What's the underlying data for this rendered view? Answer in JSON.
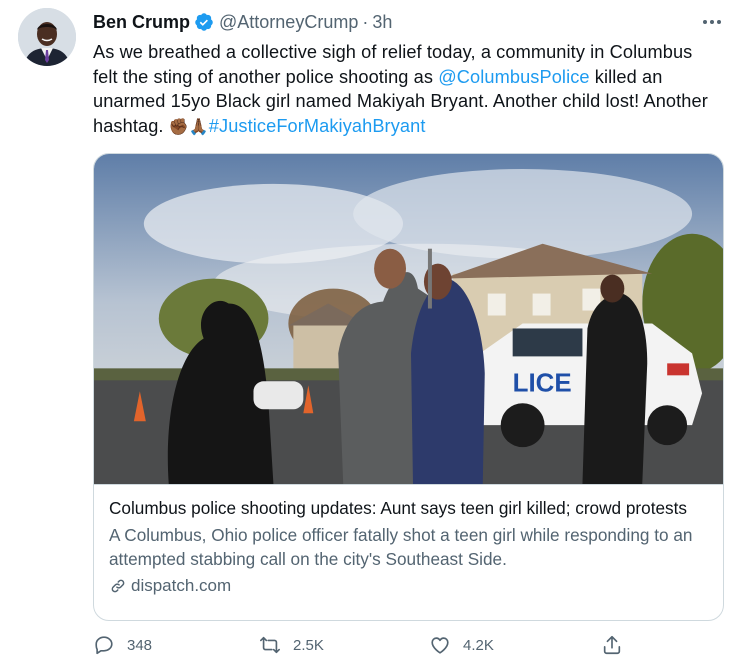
{
  "author": {
    "display_name": "Ben Crump",
    "handle": "@AttorneyCrump",
    "separator": "·",
    "time": "3h",
    "avatar_icon": "avatar",
    "verified_icon": "verified-badge-icon",
    "verified_color": "#1d9bf0"
  },
  "tweet": {
    "part1": "As we breathed a collective sigh of relief today, a community in Columbus felt the sting of another police shooting as ",
    "mention": "@ColumbusPolice",
    "part2": " killed an unarmed 15yo Black girl named Makiyah Bryant. Another child lost! Another hashtag. ",
    "emoji_fist": "✊🏾",
    "emoji_pray": "🙏🏾",
    "hashtag": "#JusticeForMakiyahBryant",
    "link_color": "#1d9bf0"
  },
  "card": {
    "title": "Columbus police shooting updates: Aunt says teen girl killed; crowd protests",
    "description": "A Columbus, Ohio police officer fatally shot a teen girl while responding to an attempted stabbing call on the city's Southeast Side.",
    "domain": "dispatch.com",
    "image_text": "LICE"
  },
  "actions": {
    "reply_count": "348",
    "retweet_count": "2.5K",
    "like_count": "4.2K"
  }
}
